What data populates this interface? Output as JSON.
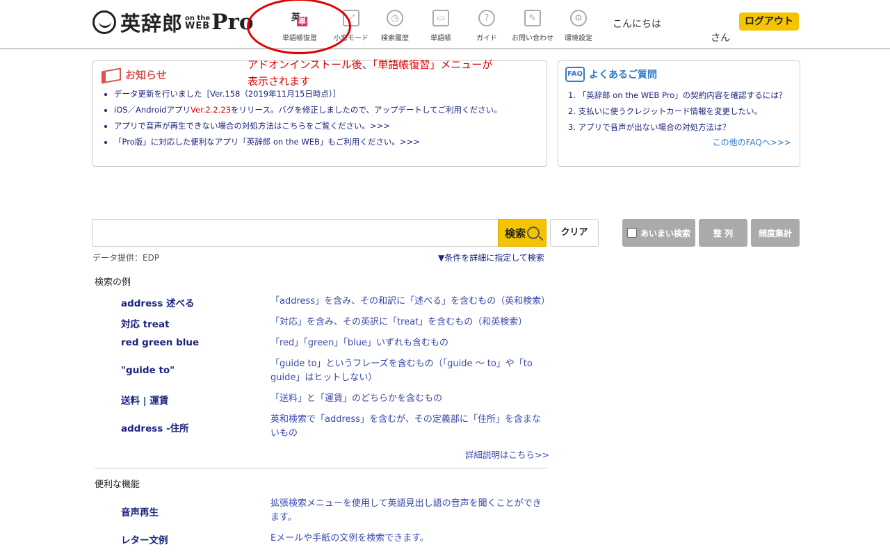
{
  "header": {
    "logo": {
      "main": "英辞郎",
      "sub_top": "on the",
      "sub_bottom": "WEB",
      "pro": "Pro"
    },
    "nav": [
      {
        "label": "単語帳復習",
        "icon": "flashcard-review-icon",
        "glyph1": "英",
        "glyph2": "単"
      },
      {
        "label": "小窓モード",
        "icon": "window-mode-icon",
        "glyph": "⤢"
      },
      {
        "label": "検索履歴",
        "icon": "clock-icon",
        "glyph": "◷"
      },
      {
        "label": "単語帳",
        "icon": "wordbook-icon",
        "glyph": "▭"
      },
      {
        "label": "ガイド",
        "icon": "question-icon",
        "glyph": "?"
      },
      {
        "label": "お問い合わせ",
        "icon": "pen-icon",
        "glyph": "✎"
      },
      {
        "label": "環境設定",
        "icon": "gear-icon",
        "glyph": "⚙"
      }
    ],
    "greeting": "こんにちは",
    "honorific": "さん",
    "logout_label": "ログアウト"
  },
  "annotation": {
    "line1": "アドオンインストール後、「単語帳復習」メニューが",
    "line2": "表示されます",
    "color": "#e00000"
  },
  "news": {
    "title": "お知らせ",
    "items": [
      {
        "text": "データ更新を行いました［Ver.158（2019年11月15日時点）］"
      },
      {
        "pre": "iOS／Androidアプリ",
        "ver": "Ver.2.2.23",
        "post": "をリリース。バグを修正しましたので、アップデートしてご利用ください。"
      },
      {
        "text": "アプリで音声が再生できない場合の対処方法はこちらをご覧ください。>>>"
      },
      {
        "text": "「Pro版」に対応した便利なアプリ「英辞郎 on the WEB」もご利用ください。>>>"
      }
    ]
  },
  "faq": {
    "badge": "FAQ",
    "title": "よくあるご質問",
    "items": [
      "1. 「英辞郎 on the WEB Pro」の契約内容を確認するには？",
      "2. 支払いに使うクレジットカード情報を変更したい。",
      "3. アプリで音声が出ない場合の対処方法は？"
    ],
    "more": "この他のFAQへ>>>"
  },
  "search": {
    "value": "",
    "placeholder": "",
    "search_label": "検索",
    "clear_label": "クリア",
    "fuzzy_label": "あいまい検索",
    "arrange_label": "整 列",
    "freq_label": "頻度集計",
    "data_source": "データ提供：EDP",
    "advanced_link": "▼条件を詳細に指定して検索"
  },
  "examples": {
    "title": "検索の例",
    "rows": [
      {
        "key": "address 述べる",
        "desc": "「address」を含み、その和訳に「述べる」を含むもの（英和検索）"
      },
      {
        "key": "対応 treat",
        "desc": "「対応」を含み、その英訳に「treat」を含むもの（和英検索）"
      },
      {
        "key": "red green blue",
        "desc": "「red」「green」「blue」いずれも含むもの"
      },
      {
        "key": "\"guide to\"",
        "desc": "「guide to」というフレーズを含むもの（「guide ～ to」や「to guide」はヒットしない）"
      },
      {
        "key": "送料 | 運賃",
        "desc": "「送料」と「運賃」のどちらかを含むもの"
      },
      {
        "key": "address -住所",
        "desc": "英和検索で「address」を含むが、その定義部に「住所」を含まないもの"
      }
    ],
    "detail_link": "詳細説明はこちら>>"
  },
  "features": {
    "title": "便利な機能",
    "rows": [
      {
        "key": "音声再生",
        "desc": "拡張検索メニューを使用して英語見出し語の音声を聞くことができます。"
      },
      {
        "key": "レター文例",
        "desc": "Eメールや手紙の文例を検索できます。"
      }
    ]
  }
}
